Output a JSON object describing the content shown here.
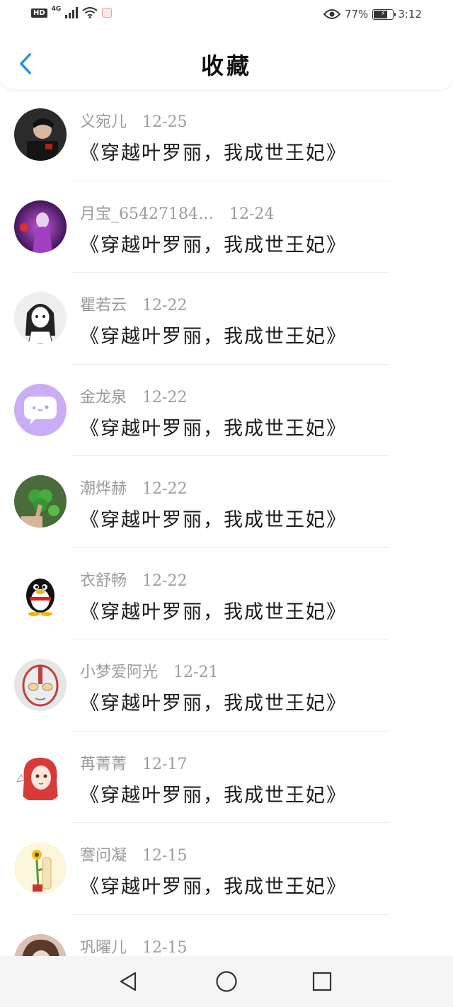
{
  "status_bar": {
    "network_badge": "HD",
    "network_type": "4G",
    "battery_percent": "77%",
    "time": "3:12",
    "battery_level": 0.77
  },
  "header": {
    "title": "收藏",
    "back_icon": "chevron-left-icon",
    "accent_color": "#1e90e0"
  },
  "items": [
    {
      "name": "义宛儿",
      "date": "12-25",
      "book": "《穿越叶罗丽，我成世王妃》",
      "avatar": "dark-portrait"
    },
    {
      "name": "月宝_65427184…",
      "date": "12-24",
      "book": "《穿越叶罗丽，我成世王妃》",
      "avatar": "purple-fantasy"
    },
    {
      "name": "瞿若云",
      "date": "12-22",
      "book": "《穿越叶罗丽，我成世王妃》",
      "avatar": "manga-girl"
    },
    {
      "name": "金龙泉",
      "date": "12-22",
      "book": "《穿越叶罗丽，我成世王妃》",
      "avatar": "chat-bubble"
    },
    {
      "name": "潮烨赫",
      "date": "12-22",
      "book": "《穿越叶罗丽，我成世王妃》",
      "avatar": "clover-leaf"
    },
    {
      "name": "衣舒畅",
      "date": "12-22",
      "book": "《穿越叶罗丽，我成世王妃》",
      "avatar": "qq-penguin"
    },
    {
      "name": "小梦爱阿光",
      "date": "12-21",
      "book": "《穿越叶罗丽，我成世王妃》",
      "avatar": "ultraman"
    },
    {
      "name": "苒菁菁",
      "date": "12-17",
      "book": "《穿越叶罗丽，我成世王妃》",
      "avatar": "red-hair-girl"
    },
    {
      "name": "謇问凝",
      "date": "12-15",
      "book": "《穿越叶罗丽，我成世王妃》",
      "avatar": "sunflower"
    },
    {
      "name": "巩曜儿",
      "date": "12-15",
      "book": "",
      "avatar": "photo-girl"
    }
  ],
  "nav_bar": {
    "back": "triangle-back-icon",
    "home": "circle-home-icon",
    "recents": "square-recents-icon"
  }
}
